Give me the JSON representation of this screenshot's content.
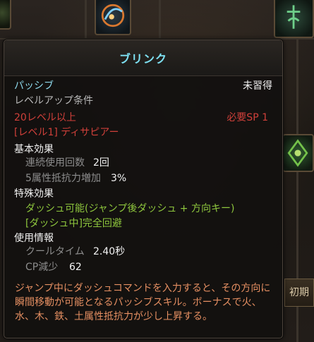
{
  "tooltip": {
    "title": "ブリンク",
    "skill_type": "パッシブ",
    "learn_status": "未習得",
    "levelup_heading": "レベルアップ条件",
    "level_requirement": "20レベル以上",
    "sp_requirement": "必要SP 1",
    "level_name": "[レベル1] ディサピアー",
    "basic_effects": {
      "heading": "基本効果",
      "items": [
        {
          "label": "連続使用回数",
          "value": "2回"
        },
        {
          "label": "5属性抵抗力増加",
          "value": "3%"
        }
      ]
    },
    "special_effects": {
      "heading": "特殊効果",
      "items": [
        "ダッシュ可能(ジャンプ後ダッシュ + 方向キー)",
        "[ダッシュ中]完全回避"
      ]
    },
    "usage_info": {
      "heading": "使用情報",
      "items": [
        {
          "label": "クールタイム",
          "value": "2.40秒"
        },
        {
          "label": "CP減少",
          "value": "62"
        }
      ]
    },
    "description": "ジャンプ中にダッシュコマンドを入力すると、その方向に瞬間移動が可能となるパッシブスキル。ボーナスで火、水、木、鉄、土属性抵抗力が少し上昇する。"
  },
  "background": {
    "side_button_label": "初期化",
    "icons": [
      "dash-swirl-skill-icon",
      "rune-skill-icon",
      "cross-skill-icon",
      "leaf-skill-icon"
    ]
  },
  "colors": {
    "title": "#7ee0f2",
    "passive": "#8ed9ec",
    "requirement_red": "#d0403a",
    "special_green": "#8ec63d",
    "description_orange": "#e58f62"
  }
}
